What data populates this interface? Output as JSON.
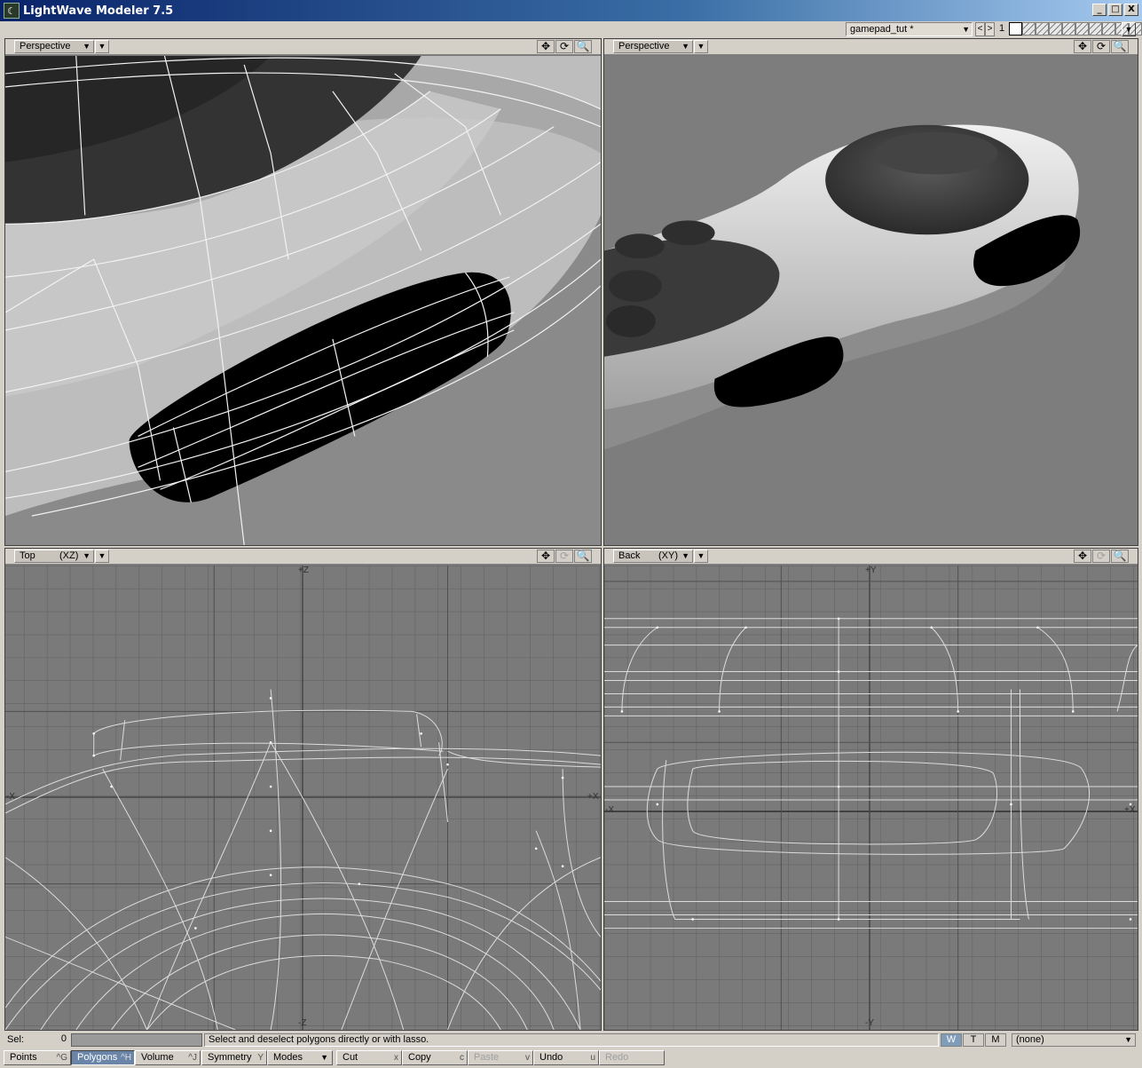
{
  "window": {
    "title": "LightWave Modeler 7.5",
    "icon": "lightwave-logo-icon",
    "icon_glyph": "☾",
    "buttons": {
      "minimize": "_",
      "maximize": "□",
      "close": "X"
    }
  },
  "topbar": {
    "object_name": "gamepad_tut *",
    "layer_prev": "<",
    "layer_next": ">",
    "layer_number": "1",
    "layers_count": 10,
    "layer_menu": "▼"
  },
  "viewports": [
    {
      "id": "tl",
      "view": "Perspective",
      "axis": "",
      "arrow": "▼",
      "menu": "▼",
      "tools": {
        "move": "✥",
        "rotate": "⟳",
        "zoom": "🔍"
      },
      "rotate_enabled": true
    },
    {
      "id": "tr",
      "view": "Perspective",
      "axis": "",
      "arrow": "▼",
      "menu": "▼",
      "tools": {
        "move": "✥",
        "rotate": "⟳",
        "zoom": "🔍"
      },
      "rotate_enabled": true
    },
    {
      "id": "bl",
      "view": "Top",
      "axis": "(XZ)",
      "arrow": "▼",
      "menu": "▼",
      "tools": {
        "move": "✥",
        "rotate": "⟳",
        "zoom": "🔍"
      },
      "rotate_enabled": false,
      "axis_labels": {
        "top": "+Z",
        "bottom": "-Z",
        "left": "-X",
        "right": "+X"
      }
    },
    {
      "id": "br",
      "view": "Back",
      "axis": "(XY)",
      "arrow": "▼",
      "menu": "▼",
      "tools": {
        "move": "✥",
        "rotate": "⟳",
        "zoom": "🔍"
      },
      "rotate_enabled": false,
      "axis_labels": {
        "top": "+Y",
        "bottom": "-Y",
        "left": "-X",
        "right": "+X"
      }
    }
  ],
  "status": {
    "sel_label": "Sel:",
    "sel_count": "0",
    "message": "Select and deselect polygons directly or with lasso.",
    "wtm": [
      "W",
      "T",
      "M"
    ],
    "wtm_active": "W",
    "description": "(none)",
    "description_arrow": "▼"
  },
  "bottom": {
    "points": {
      "label": "Points",
      "key": "^G"
    },
    "polygons": {
      "label": "Polygons",
      "key": "^H"
    },
    "volume": {
      "label": "Volume",
      "key": "^J"
    },
    "symmetry": {
      "label": "Symmetry",
      "key": "Y"
    },
    "modes": {
      "label": "Modes",
      "arrow": "▼"
    },
    "cut": {
      "label": "Cut",
      "key": "x"
    },
    "copy": {
      "label": "Copy",
      "key": "c"
    },
    "paste": {
      "label": "Paste",
      "key": "v"
    },
    "undo": {
      "label": "Undo",
      "key": "u"
    },
    "redo": {
      "label": "Redo"
    }
  }
}
